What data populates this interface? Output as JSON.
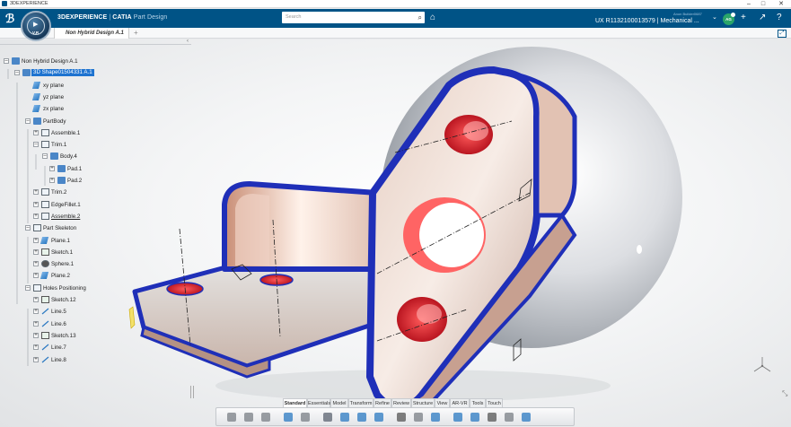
{
  "os_bar": {
    "title": "3DEXPERIENCE",
    "minimize": "–",
    "maximize": "□",
    "close": "✕"
  },
  "header": {
    "brand": "3DEXPERIENCE",
    "separator": " | ",
    "app": "CATIA",
    "module": " Part Design",
    "search_placeholder": "Search",
    "user": "Anon Builder0687",
    "title": "UX R1132100013579 | Mechanical ...",
    "avatar_initials": "AG",
    "colors": {
      "bar": "#005386",
      "selection": "#1e73d0",
      "edge_blue": "#1f2fb8"
    }
  },
  "tab": {
    "label": "Non Hybrid Design A.1",
    "add": "+"
  },
  "tree": {
    "nodes": [
      {
        "label": "Non Hybrid Design A.1",
        "icon": "product-icon",
        "expander": "–"
      },
      {
        "label": "3D Shape01504331 A.1",
        "icon": "part-icon",
        "expander": "–",
        "selected": true
      },
      {
        "label": "xy plane",
        "icon": "plane-icon"
      },
      {
        "label": "yz plane",
        "icon": "plane-icon"
      },
      {
        "label": "zx plane",
        "icon": "plane-icon"
      },
      {
        "label": "PartBody",
        "icon": "body-icon",
        "expander": "–"
      },
      {
        "label": "Assemble.1",
        "icon": "assemble-icon",
        "expander": "+"
      },
      {
        "label": "Trim.1",
        "icon": "trim-icon",
        "expander": "–"
      },
      {
        "label": "Body.4",
        "icon": "body-icon",
        "expander": "–"
      },
      {
        "label": "Pad.1",
        "icon": "pad-icon",
        "expander": "+"
      },
      {
        "label": "Pad.2",
        "icon": "pad-icon",
        "expander": "+"
      },
      {
        "label": "Trim.2",
        "icon": "trim-icon",
        "expander": "+"
      },
      {
        "label": "EdgeFillet.1",
        "icon": "fillet-icon",
        "expander": "+"
      },
      {
        "label": "Assemble.2",
        "icon": "assemble-icon",
        "expander": "+",
        "underline": true
      },
      {
        "label": "Part Skeleton",
        "icon": "skeleton-icon",
        "expander": "–"
      },
      {
        "label": "Plane.1",
        "icon": "plane-icon",
        "expander": "+"
      },
      {
        "label": "Sketch.1",
        "icon": "sketch-icon",
        "expander": "+"
      },
      {
        "label": "Sphere.1",
        "icon": "sphere-icon",
        "expander": "+"
      },
      {
        "label": "Plane.2",
        "icon": "plane-icon",
        "expander": "+"
      },
      {
        "label": "Holes Positioning",
        "icon": "skeleton-icon",
        "expander": "–"
      },
      {
        "label": "Sketch.12",
        "icon": "sketch-icon",
        "expander": "+"
      },
      {
        "label": "Line.5",
        "icon": "line-icon",
        "expander": "+"
      },
      {
        "label": "Line.6",
        "icon": "line-icon",
        "expander": "+"
      },
      {
        "label": "Sketch.13",
        "icon": "sketch-icon",
        "expander": "+"
      },
      {
        "label": "Line.7",
        "icon": "line-icon",
        "expander": "+"
      },
      {
        "label": "Line.8",
        "icon": "line-icon",
        "expander": "+"
      }
    ]
  },
  "action_bar": {
    "sections": [
      "Standard",
      "Essentials",
      "Model",
      "Transform",
      "Refine",
      "Review",
      "Structure",
      "View",
      "AR-VR",
      "Tools",
      "Touch"
    ],
    "active_section": "Standard",
    "tools": [
      "cut-icon",
      "copy-icon",
      "paste-icon",
      "undo-icon",
      "update-icon",
      "zoom-icon",
      "pan-icon",
      "rotate-icon",
      "search-icon",
      "capture-icon",
      "render-icon",
      "view-cube-icon",
      "properties-icon",
      "measure-icon",
      "material-icon",
      "settings-icon",
      "screen-icon"
    ]
  }
}
